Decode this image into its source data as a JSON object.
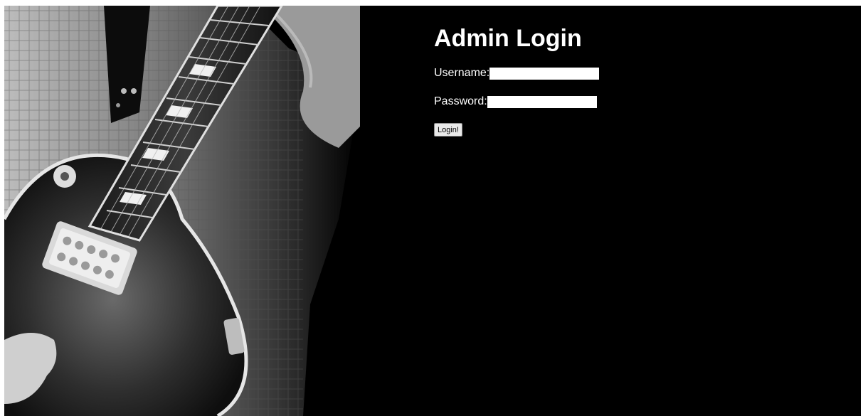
{
  "login": {
    "title": "Admin Login",
    "username_label": "Username:",
    "username_value": "",
    "password_label": "Password:",
    "password_value": "",
    "submit_label": "Login!"
  },
  "colors": {
    "background": "#000000",
    "text": "#ffffff",
    "field_background": "#ffffff",
    "button_background": "#e9e9e9"
  },
  "hero": {
    "subject": "black-and-white photo of a person playing an electric guitar"
  }
}
